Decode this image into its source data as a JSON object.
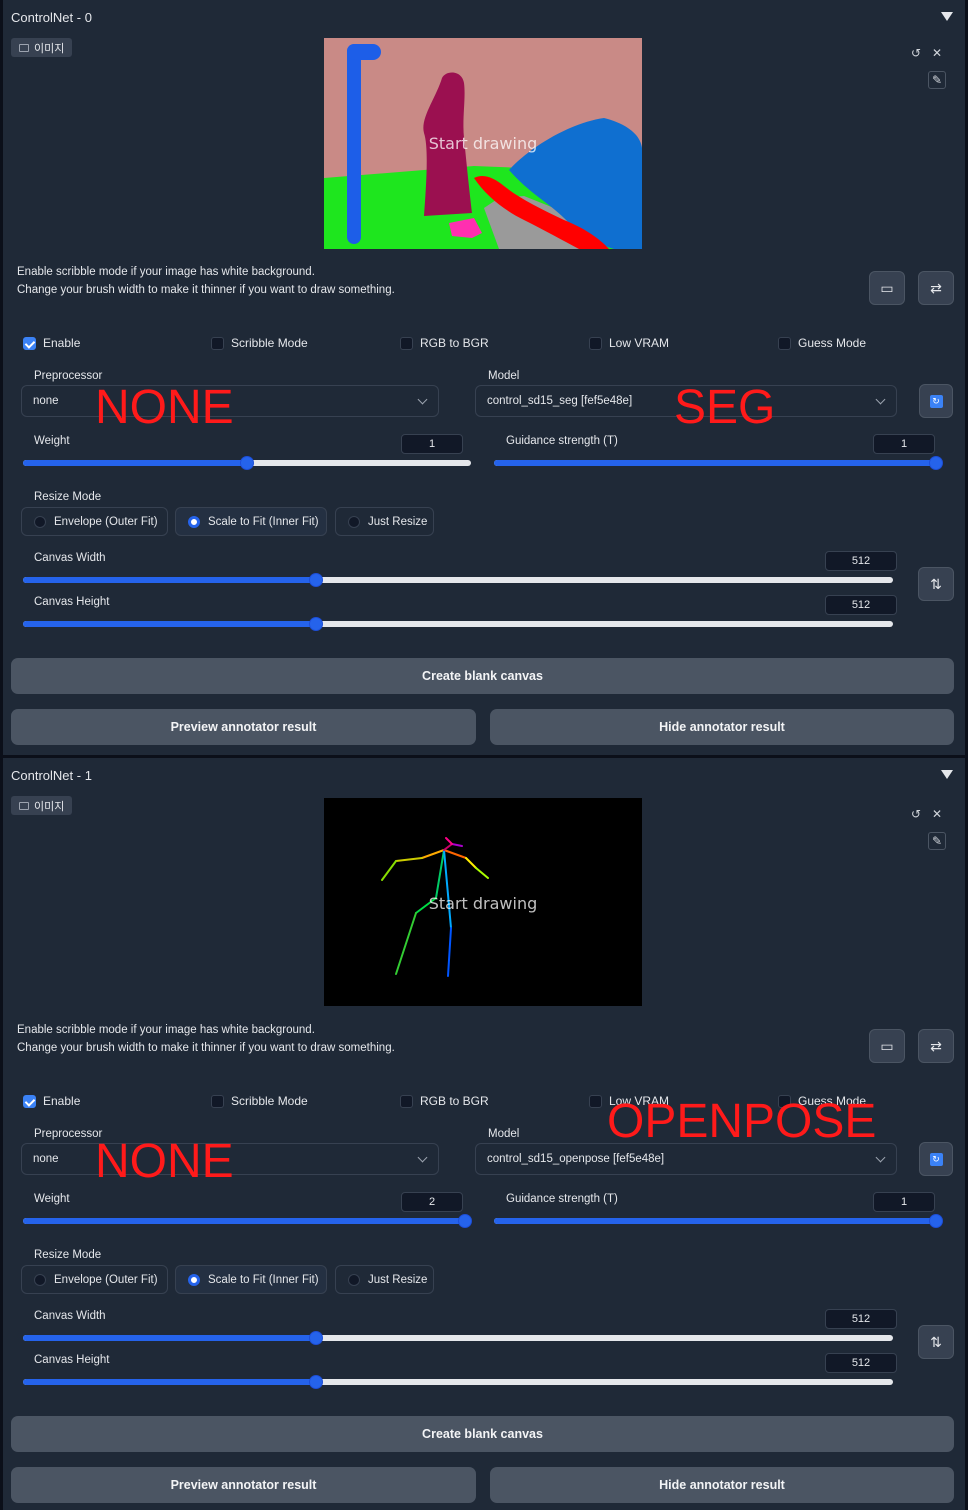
{
  "units": [
    {
      "title": "ControlNet - 0",
      "image_tab": "이미지",
      "canvas_text": "Start drawing",
      "hint_line1": "Enable scribble mode if your image has white background.",
      "hint_line2": "Change your brush width to make it thinner if you want to draw something.",
      "checkboxes": [
        {
          "label": "Enable",
          "checked": true
        },
        {
          "label": "Scribble Mode",
          "checked": false
        },
        {
          "label": "RGB to BGR",
          "checked": false
        },
        {
          "label": "Low VRAM",
          "checked": false
        },
        {
          "label": "Guess Mode",
          "checked": false
        }
      ],
      "preprocessor_label": "Preprocessor",
      "preprocessor_value": "none",
      "model_label": "Model",
      "model_value": "control_sd15_seg [fef5e48e]",
      "weight_label": "Weight",
      "weight_value": "1",
      "weight_fraction": 0.5,
      "guidance_label": "Guidance strength (T)",
      "guidance_value": "1",
      "guidance_fraction": 1.0,
      "resize_label": "Resize Mode",
      "resize_options": [
        "Envelope (Outer Fit)",
        "Scale to Fit (Inner Fit)",
        "Just Resize"
      ],
      "resize_selected": "Scale to Fit (Inner Fit)",
      "canvas_width_label": "Canvas Width",
      "canvas_width_value": "512",
      "canvas_width_fraction": 0.337,
      "canvas_height_label": "Canvas Height",
      "canvas_height_value": "512",
      "canvas_height_fraction": 0.337,
      "create_canvas_label": "Create blank canvas",
      "preview_label": "Preview annotator result",
      "hide_label": "Hide annotator result",
      "overlay_left": "NONE",
      "overlay_right": "SEG"
    },
    {
      "title": "ControlNet - 1",
      "image_tab": "이미지",
      "canvas_text": "Start drawing",
      "hint_line1": "Enable scribble mode if your image has white background.",
      "hint_line2": "Change your brush width to make it thinner if you want to draw something.",
      "checkboxes": [
        {
          "label": "Enable",
          "checked": true
        },
        {
          "label": "Scribble Mode",
          "checked": false
        },
        {
          "label": "RGB to BGR",
          "checked": false
        },
        {
          "label": "Low VRAM",
          "checked": false
        },
        {
          "label": "Guess Mode",
          "checked": false
        }
      ],
      "preprocessor_label": "Preprocessor",
      "preprocessor_value": "none",
      "model_label": "Model",
      "model_value": "control_sd15_openpose [fef5e48e]",
      "weight_label": "Weight",
      "weight_value": "2",
      "weight_fraction": 1.0,
      "guidance_label": "Guidance strength (T)",
      "guidance_value": "1",
      "guidance_fraction": 1.0,
      "resize_label": "Resize Mode",
      "resize_options": [
        "Envelope (Outer Fit)",
        "Scale to Fit (Inner Fit)",
        "Just Resize"
      ],
      "resize_selected": "Scale to Fit (Inner Fit)",
      "canvas_width_label": "Canvas Width",
      "canvas_width_value": "512",
      "canvas_width_fraction": 0.337,
      "canvas_height_label": "Canvas Height",
      "canvas_height_value": "512",
      "canvas_height_fraction": 0.337,
      "create_canvas_label": "Create blank canvas",
      "preview_label": "Preview annotator result",
      "hide_label": "Hide annotator result",
      "overlay_left": "NONE",
      "overlay_right": "OPENPOSE"
    }
  ],
  "colors": {
    "accent": "#2563eb",
    "panel": "#1f2937",
    "overlay": "#ff1a1a"
  }
}
